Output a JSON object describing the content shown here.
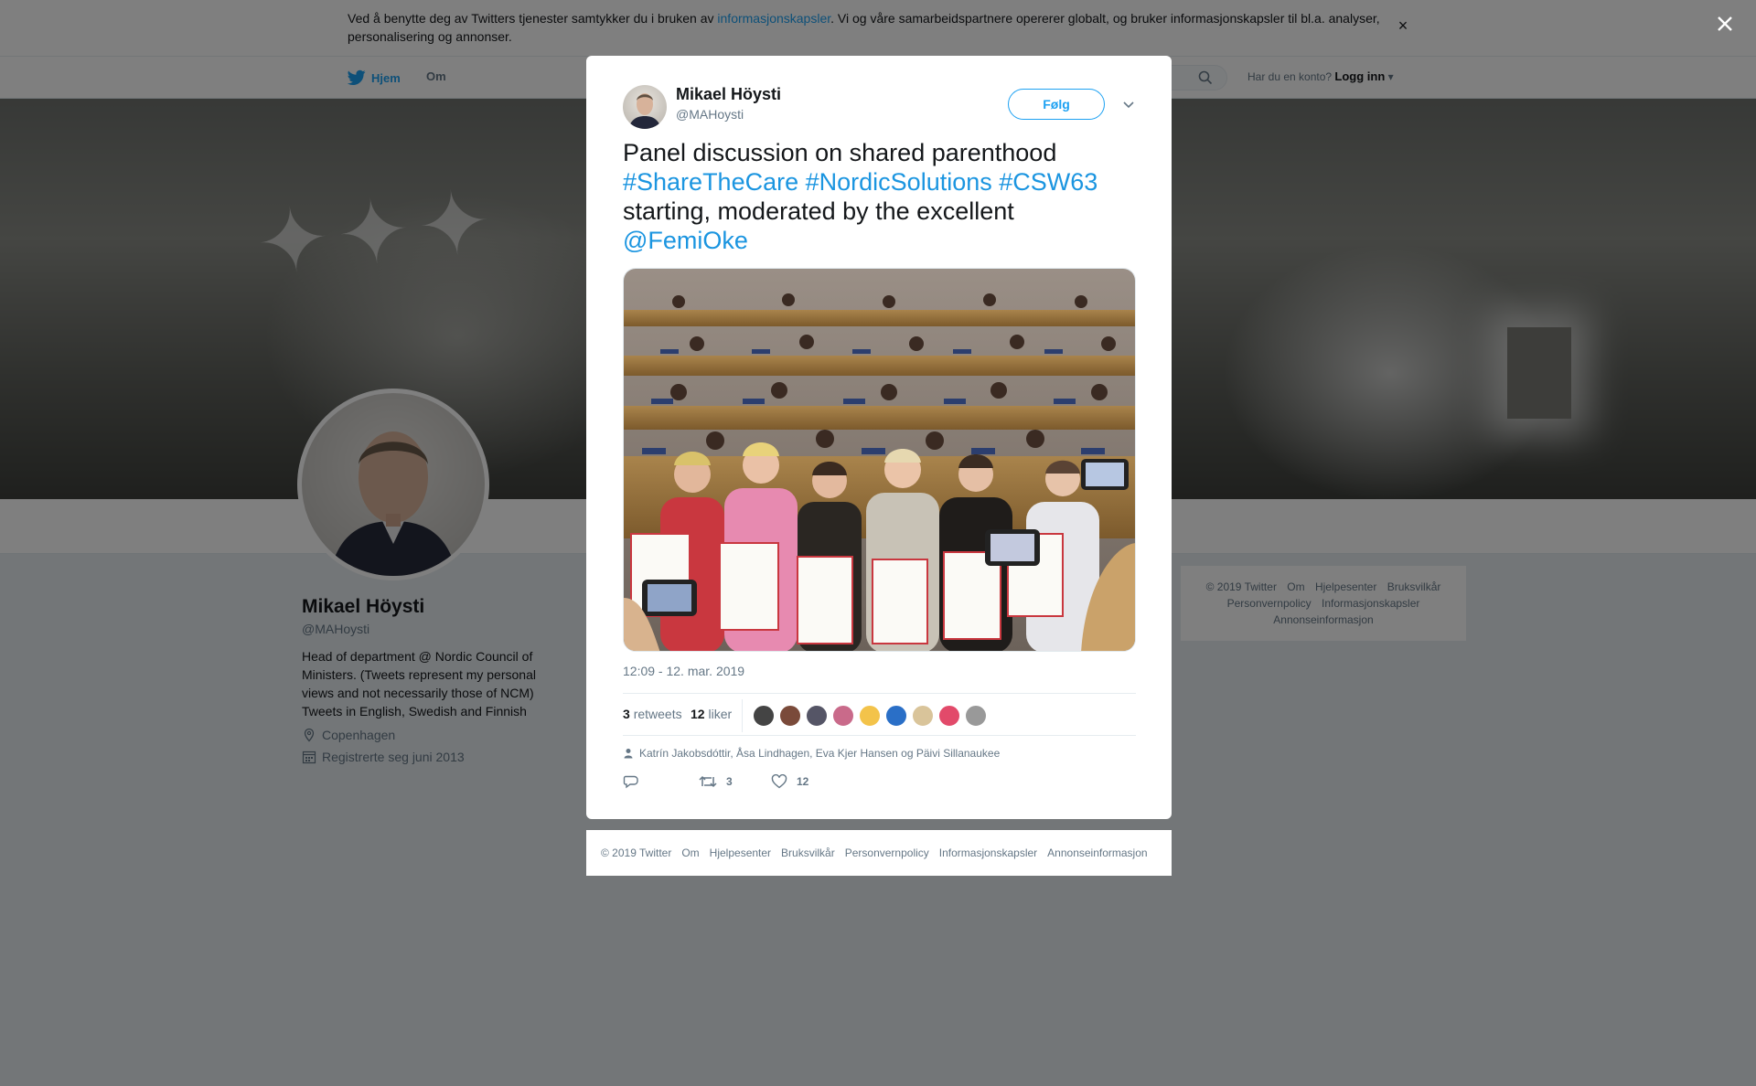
{
  "cookie": {
    "text_before": "Ved å benytte deg av Twitters tjenester samtykker du i bruken av ",
    "link": "informasjonskapsler",
    "text_after": ". Vi og våre samarbeidspartnere opererer globalt, og bruker informasjonskapsler til bl.a. analyser, personalisering og annonser.",
    "close": "×"
  },
  "nav": {
    "home": "Hjem",
    "about": "Om",
    "login_prompt": "Har du en konto?",
    "login": "Logg inn"
  },
  "profile": {
    "name": "Mikael Höysti",
    "handle": "@MAHoysti",
    "bio": "Head of department @ Nordic Council of Ministers. (Tweets represent my personal views and not necessarily those of NCM) Tweets in English, Swedish and Finnish",
    "location": "Copenhagen",
    "joined": "Registrerte seg juni 2013"
  },
  "side_footer": {
    "links": [
      "© 2019 Twitter",
      "Om",
      "Hjelpesenter",
      "Bruksvilkår",
      "Personvernpolicy",
      "Informasjonskapsler",
      "Annonseinformasjon"
    ]
  },
  "tweet": {
    "author_name": "Mikael Höysti",
    "author_handle": "@MAHoysti",
    "follow_label": "Følg",
    "text_plain_1": "Panel discussion on shared parenthood ",
    "hashtag_1": "#ShareTheCare",
    "hashtag_2": "#NordicSolutions",
    "hashtag_3": "#CSW63",
    "text_plain_2": " starting, moderated by the excellent ",
    "mention": "@FemiOke",
    "timestamp": "12:09 - 12. mar. 2019",
    "retweets_count": "3",
    "retweets_label": "retweets",
    "likes_count": "12",
    "likes_label": "liker",
    "liked_by": "Katrín Jakobsdóttir, Åsa Lindhagen, Eva Kjer Hansen og Päivi Sillanaukee",
    "action_retweet_count": "3",
    "action_like_count": "12",
    "icons": [
      "reply-icon",
      "retweet-icon",
      "heart-icon",
      "person-icon",
      "chevron-down-icon"
    ]
  },
  "modal_footer": {
    "links": [
      "© 2019 Twitter",
      "Om",
      "Hjelpesenter",
      "Bruksvilkår",
      "Personvernpolicy",
      "Informasjonskapsler",
      "Annonseinformasjon"
    ]
  },
  "colors": {
    "twitter_blue": "#1da1f2",
    "link_blue": "#1b95e0",
    "muted_text": "#657786",
    "overlay": "rgba(0,0,0,0.5)"
  }
}
